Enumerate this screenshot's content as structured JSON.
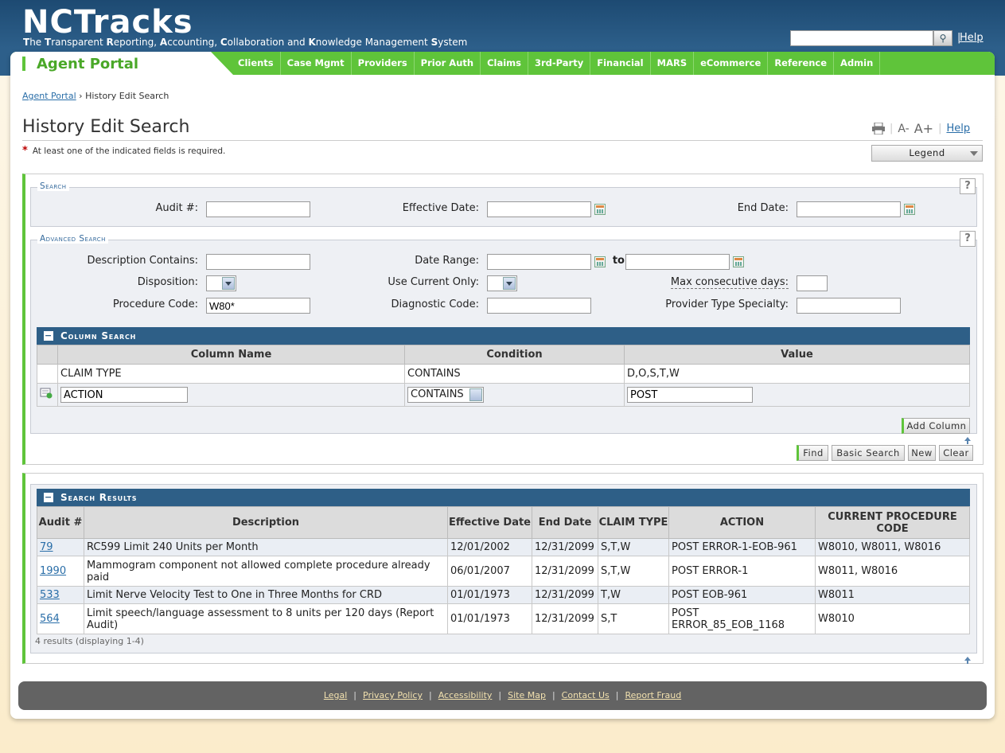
{
  "header": {
    "logo": "NCTracks",
    "tagline_parts": [
      {
        "b": "T",
        "t": "he "
      },
      {
        "b": "T",
        "t": "ransparent "
      },
      {
        "b": "R",
        "t": "eporting, "
      },
      {
        "b": "A",
        "t": "ccounting, "
      },
      {
        "b": "C",
        "t": "ollaboration and "
      },
      {
        "b": "K",
        "t": "nowledge Management "
      },
      {
        "b": "S",
        "t": "ystem"
      }
    ],
    "help": "Help",
    "sep": "|"
  },
  "nav": {
    "portal": "Agent Portal",
    "items": [
      "Clients",
      "Case Mgmt",
      "Providers",
      "Prior Auth",
      "Claims",
      "3rd-Party",
      "Financial",
      "MARS",
      "eCommerce",
      "Reference",
      "Admin"
    ]
  },
  "breadcrumb": {
    "link": "Agent Portal",
    "sep": "›",
    "current": "History Edit Search"
  },
  "page": {
    "title": "History Edit Search",
    "required_note": "At least one of the indicated fields is required.",
    "required_star": "*",
    "legend": "Legend",
    "help": "Help",
    "font_minus": "A-",
    "font_plus": "A+"
  },
  "search": {
    "legend": "Search",
    "audit_label": "Audit #:",
    "audit_value": "",
    "effective_label": "Effective Date:",
    "effective_value": "",
    "end_label": "End Date:",
    "end_value": ""
  },
  "advanced": {
    "legend": "Advanced Search",
    "desc_label": "Description Contains:",
    "desc_value": "",
    "range_label": "Date Range:",
    "range_to": "to",
    "disp_label": "Disposition:",
    "current_label": "Use Current Only:",
    "maxdays_label": "Max consecutive days:",
    "proc_label": "Procedure Code:",
    "proc_value": "W80*",
    "diag_label": "Diagnostic Code:",
    "diag_value": "",
    "prov_label": "Provider Type Specialty:",
    "prov_value": ""
  },
  "column_search": {
    "title": "Column Search",
    "headers": [
      "Column Name",
      "Condition",
      "Value"
    ],
    "row": {
      "name": "CLAIM TYPE",
      "condition": "CONTAINS",
      "value": "D,O,S,T,W"
    },
    "edit": {
      "name": "ACTION",
      "condition": "CONTAINS",
      "value": "POST"
    },
    "add_column": "Add Column"
  },
  "buttons": {
    "find": "Find",
    "basic": "Basic Search",
    "new": "New",
    "clear": "Clear"
  },
  "results": {
    "title": "Search Results",
    "headers": [
      "Audit #",
      "Description",
      "Effective Date",
      "End Date",
      "CLAIM TYPE",
      "ACTION",
      "CURRENT PROCEDURE CODE"
    ],
    "rows": [
      {
        "audit": "79",
        "desc": "RC599 Limit 240 Units per Month",
        "eff": "12/01/2002",
        "end": "12/31/2099",
        "type": "S,T,W",
        "action": "POST ERROR-1-EOB-961",
        "code": "W8010, W8011, W8016"
      },
      {
        "audit": "1990",
        "desc": "Mammogram component not allowed complete procedure already paid",
        "eff": "06/01/2007",
        "end": "12/31/2099",
        "type": "S,T,W",
        "action": "POST ERROR-1",
        "code": "W8011, W8016"
      },
      {
        "audit": "533",
        "desc": "Limit Nerve Velocity Test to One in Three Months for CRD",
        "eff": "01/01/1973",
        "end": "12/31/2099",
        "type": "T,W",
        "action": "POST EOB-961",
        "code": "W8011"
      },
      {
        "audit": "564",
        "desc": "Limit speech/language assessment to 8 units per 120 days (Report Audit)",
        "eff": "01/01/1973",
        "end": "12/31/2099",
        "type": "S,T",
        "action": "POST ERROR_85_EOB_1168",
        "code": "W8010"
      }
    ],
    "summary": "4 results (displaying 1-4)"
  },
  "footer": {
    "links": [
      "Legal",
      "Privacy Policy",
      "Accessibility",
      "Site Map",
      "Contact Us",
      "Report Fraud"
    ]
  }
}
